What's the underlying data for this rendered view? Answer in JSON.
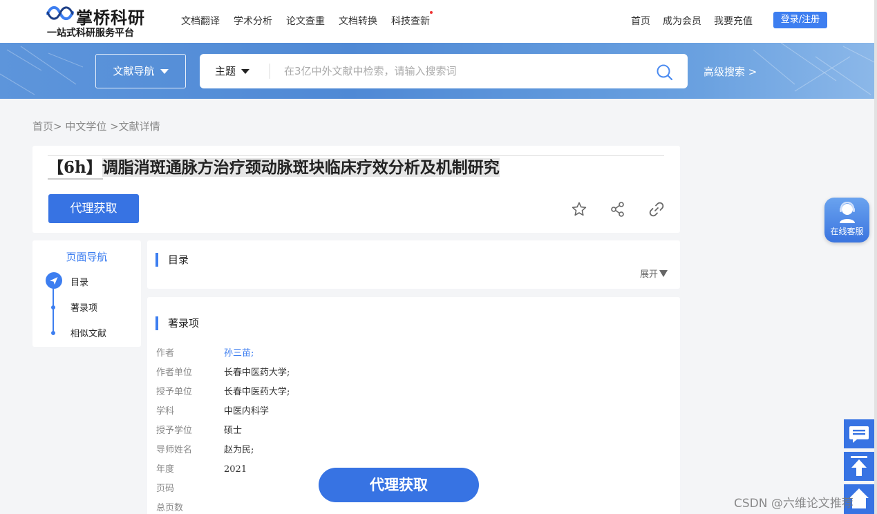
{
  "header": {
    "logo_name": "掌桥科研",
    "logo_slogan": "一站式科研服务平台",
    "nav_main": [
      "文档翻译",
      "学术分析",
      "论文查重",
      "文档转换",
      "科技查新"
    ],
    "nav_right": [
      "首页",
      "成为会员",
      "我要充值"
    ],
    "login_label": "登录/注册"
  },
  "search": {
    "doc_nav_label": "文献导航",
    "type_label": "主题",
    "placeholder": "在3亿中外文献中检索，请输入搜索词",
    "advanced_label": "高级搜索 >"
  },
  "breadcrumb": "首页> 中文学位 >文献详情",
  "document": {
    "tag": "【6h】",
    "title": "调脂消斑通脉方治疗颈动脉斑块临床疗效分析及机制研究",
    "proxy_label": "代理获取"
  },
  "page_nav": {
    "title": "页面导航",
    "items": [
      "目录",
      "著录项",
      "相似文献"
    ]
  },
  "toc": {
    "heading": "目录",
    "expand_label": "展开"
  },
  "meta": {
    "heading": "著录项",
    "rows": [
      {
        "label": "作者",
        "value": "孙三苗;"
      },
      {
        "label": "作者单位",
        "value": "长春中医药大学;"
      },
      {
        "label": "授予单位",
        "value": "长春中医药大学;"
      },
      {
        "label": "学科",
        "value": "中医内科学"
      },
      {
        "label": "授予学位",
        "value": "硕士"
      },
      {
        "label": "导师姓名",
        "value": "赵为民;"
      },
      {
        "label": "年度",
        "value": "2021"
      },
      {
        "label": "页码",
        "value": ""
      },
      {
        "label": "总页数",
        "value": ""
      }
    ]
  },
  "floating": {
    "proxy_label": "代理获取",
    "service_label": "在线客服"
  },
  "watermark": "CSDN @六维论文推荐",
  "colors": {
    "accent": "#3d7ef0",
    "button": "#3773e3",
    "banner": "#5d95db"
  }
}
